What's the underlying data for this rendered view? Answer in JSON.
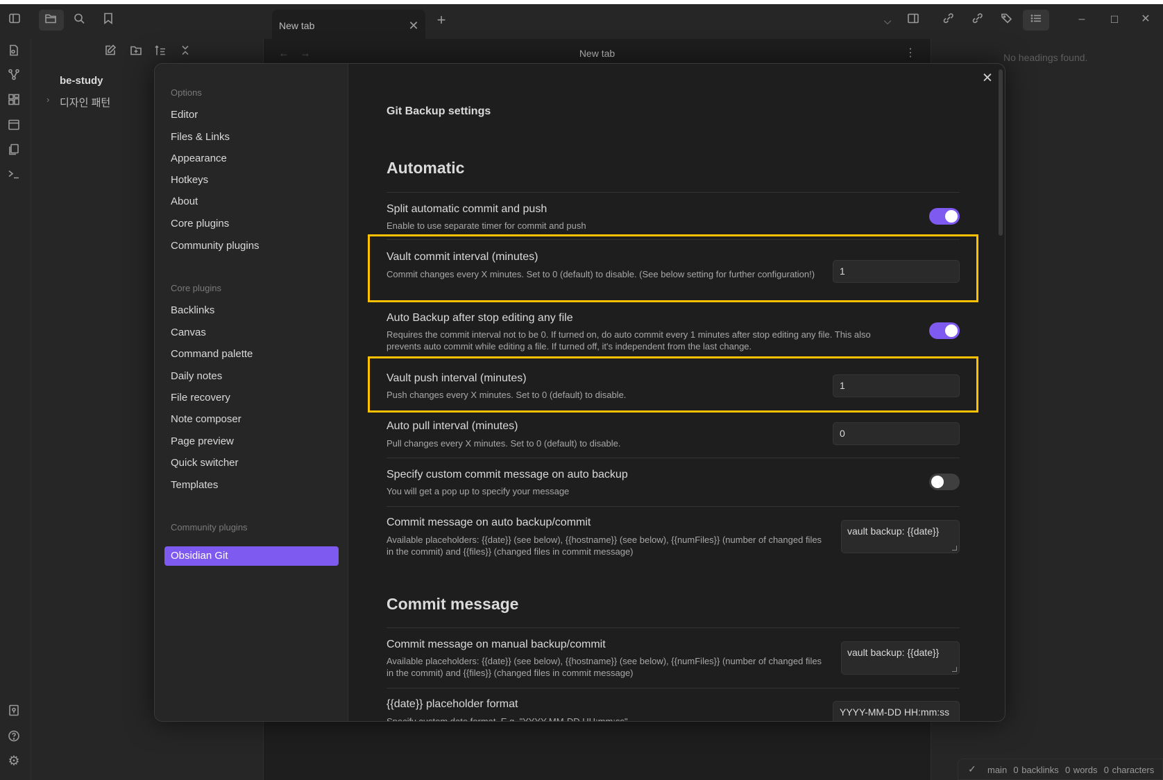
{
  "titlebar": {
    "tab_title": "New tab",
    "icons": [
      "sidebar-toggle-icon",
      "folder-icon",
      "search-icon",
      "bookmark-icon",
      "tab-close-icon",
      "new-tab-plus-icon",
      "chevron-down-icon",
      "split-panel-icon",
      "backlinks-icon",
      "outgoing-links-icon",
      "tags-icon",
      "outline-icon",
      "minimize-icon",
      "maximize-icon",
      "window-close-icon"
    ]
  },
  "ribbon": {
    "icons": [
      "quick-switcher-icon",
      "graph-view-icon",
      "canvas-icon",
      "daily-note-icon",
      "templates-icon",
      "command-palette-icon",
      "vault-icon",
      "help-icon",
      "settings-icon"
    ]
  },
  "file_explorer": {
    "vault_name": "be-study",
    "folders": [
      "디자인 패턴"
    ]
  },
  "editor": {
    "title": "New tab"
  },
  "outline": {
    "empty_text": "No headings found."
  },
  "status_bar": {
    "branch": "main",
    "backlinks": "0 backlinks",
    "words": "0 words",
    "characters": "0 characters"
  },
  "settings": {
    "nav": {
      "options_header": "Options",
      "options": [
        "Editor",
        "Files & Links",
        "Appearance",
        "Hotkeys",
        "About",
        "Core plugins",
        "Community plugins"
      ],
      "core_header": "Core plugins",
      "core": [
        "Backlinks",
        "Canvas",
        "Command palette",
        "Daily notes",
        "File recovery",
        "Note composer",
        "Page preview",
        "Quick switcher",
        "Templates"
      ],
      "community_header": "Community plugins",
      "community": [
        "Obsidian Git"
      ]
    },
    "title": "Git Backup settings",
    "sections": [
      {
        "heading": "Automatic",
        "items": [
          {
            "name": "Split automatic commit and push",
            "desc": "Enable to use separate timer for commit and push",
            "toggle": true
          },
          {
            "name": "Vault commit interval (minutes)",
            "desc": "Commit changes every X minutes. Set to 0 (default) to disable. (See below setting for further configuration!)",
            "value": "1",
            "highlighted": true
          },
          {
            "name": "Auto Backup after stop editing any file",
            "desc": "Requires the commit interval not to be 0. If turned on, do auto commit every 1 minutes after stop editing any file. This also prevents auto commit while editing a file. If turned off, it's independent from the last change.",
            "toggle": true
          },
          {
            "name": "Vault push interval (minutes)",
            "desc": "Push changes every X minutes. Set to 0 (default) to disable.",
            "value": "1",
            "highlighted": true
          },
          {
            "name": "Auto pull interval (minutes)",
            "desc": "Pull changes every X minutes. Set to 0 (default) to disable.",
            "value": "0"
          },
          {
            "name": "Specify custom commit message on auto backup",
            "desc": "You will get a pop up to specify your message",
            "toggle": false
          },
          {
            "name": "Commit message on auto backup/commit",
            "desc": "Available placeholders: {{date}} (see below), {{hostname}} (see below), {{numFiles}} (number of changed files in the commit) and {{files}} (changed files in commit message)",
            "value": "vault backup: {{date}}"
          }
        ]
      },
      {
        "heading": "Commit message",
        "items": [
          {
            "name": "Commit message on manual backup/commit",
            "desc": "Available placeholders: {{date}} (see below), {{hostname}} (see below), {{numFiles}} (number of changed files in the commit) and {{files}} (changed files in commit message)",
            "value": "vault backup: {{date}}"
          },
          {
            "name": "{{date}} placeholder format",
            "desc": "Specify custom date format. E.g. \"YYYY-MM-DD HH:mm:ss\"",
            "value": "YYYY-MM-DD HH:mm:ss"
          }
        ]
      }
    ]
  },
  "colors": {
    "accent": "#7f5af0",
    "highlight": "#ffc000",
    "background": "#1e1e1e"
  }
}
